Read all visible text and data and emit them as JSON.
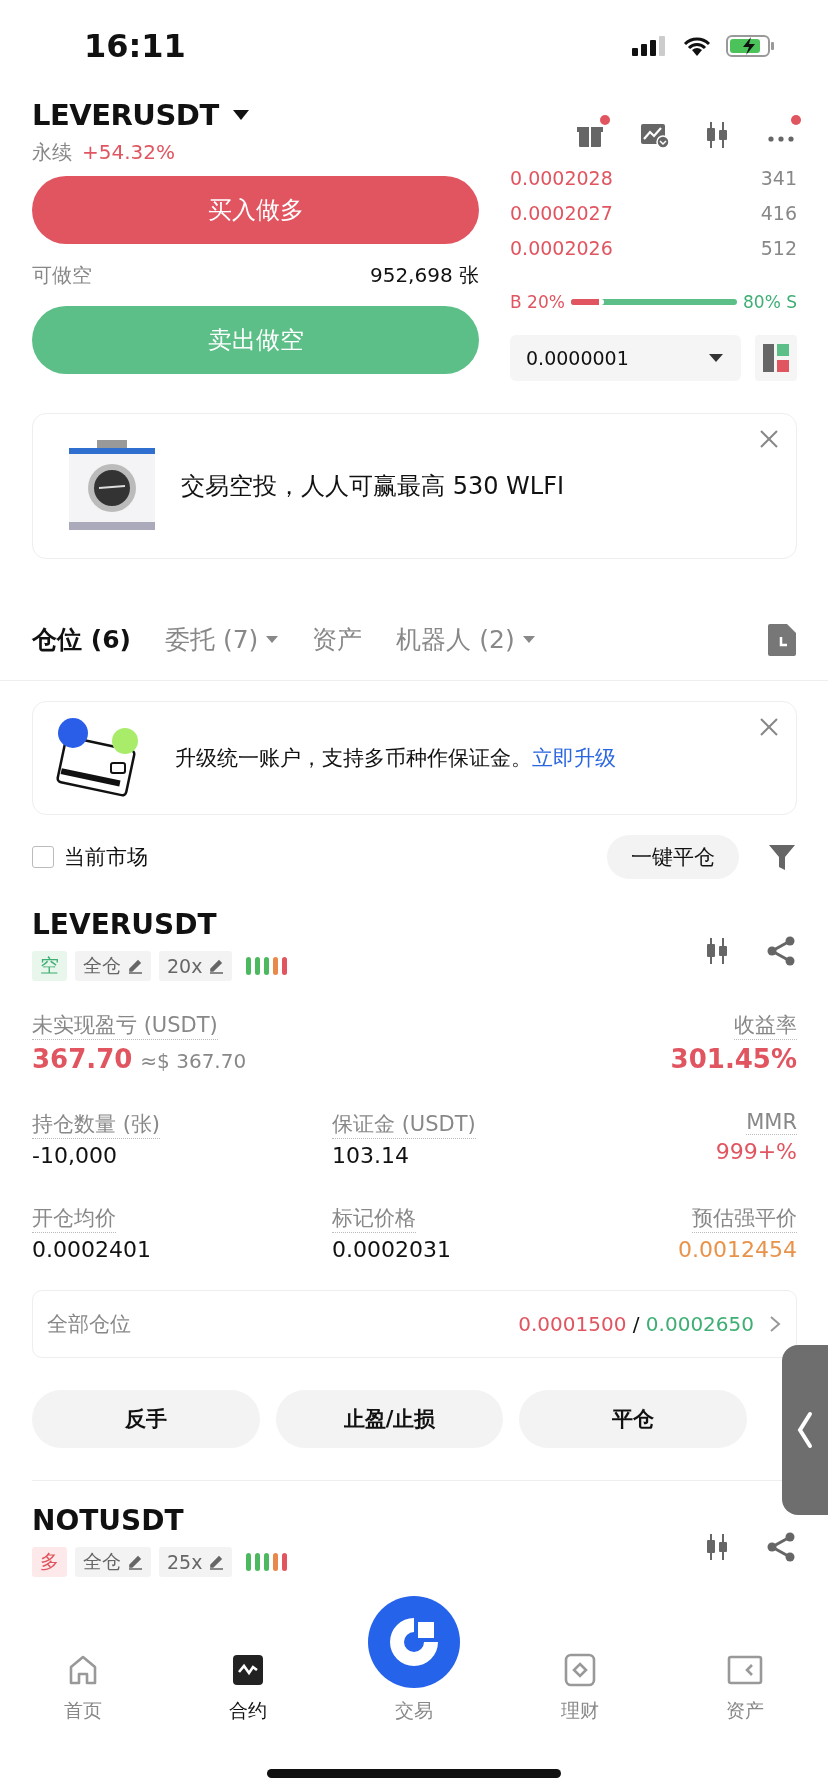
{
  "status_bar": {
    "time": "16:11"
  },
  "header": {
    "symbol": "LEVERUSDT",
    "type": "永续",
    "change": "+54.32%"
  },
  "toolbar": [
    {
      "kind": "gift",
      "badge": true
    },
    {
      "kind": "chart",
      "badge": false
    },
    {
      "kind": "candles",
      "badge": false
    },
    {
      "kind": "more",
      "badge": true
    }
  ],
  "trade": {
    "buy": "买入做多",
    "available_label": "可做空",
    "available_value": "952,698 张",
    "sell": "卖出做空"
  },
  "order_book": {
    "asks": [
      {
        "price": "0.0002028",
        "size": "341"
      },
      {
        "price": "0.0002027",
        "size": "416"
      },
      {
        "price": "0.0002026",
        "size": "512"
      }
    ],
    "buy_label": "B 20%",
    "sell_label": "80% S",
    "level": 0.2,
    "precision": "0.0000001"
  },
  "promo": {
    "text": "交易空投，人人可赢最高 530 WLFI"
  },
  "tabs": [
    {
      "label": "仓位 (6)",
      "selected": true,
      "dropdown": false
    },
    {
      "label": "委托 (7)",
      "selected": false,
      "dropdown": true
    },
    {
      "label": "资产",
      "selected": false,
      "dropdown": false
    },
    {
      "label": "机器人 (2)",
      "selected": false,
      "dropdown": true
    }
  ],
  "notice": {
    "text": "升级统一账户，支持多币种作保证金。",
    "link": "立即升级"
  },
  "filter": {
    "label": "当前市场",
    "checked": false,
    "close_all": "一键平仓"
  },
  "positions": [
    {
      "symbol": "LEVERUSDT",
      "side": "空",
      "kind": "short",
      "margin_mode": "全仓",
      "leverage": "20x",
      "risk_bars": [
        {
          "color": "#4cb860"
        },
        {
          "color": "#4cb860"
        },
        {
          "color": "#4cb860"
        },
        {
          "color": "#e8884a"
        },
        {
          "color": "#e05560"
        }
      ],
      "pnl": {
        "label": "未实现盈亏 (USDT)",
        "value": "367.70",
        "approx": "≈$ 367.70"
      },
      "roe": {
        "label": "收益率",
        "value": "301.45%"
      },
      "grid": [
        {
          "label": "持仓数量 (张)",
          "value": "-10,000",
          "kind": "plain"
        },
        {
          "label": "保证金 (USDT)",
          "value": "103.14",
          "kind": "plain"
        },
        {
          "label": "MMR",
          "value": "999+%",
          "kind": "risk"
        },
        {
          "label": "开仓均价",
          "value": "0.0002401",
          "kind": "plain"
        },
        {
          "label": "标记价格",
          "value": "0.0002031",
          "kind": "plain"
        },
        {
          "label": "预估强平价",
          "value": "0.0012454",
          "kind": "liquidation"
        }
      ],
      "range": {
        "label": "全部仓位",
        "low": "0.0001500",
        "sep": "/",
        "high": "0.0002650"
      },
      "actions": [
        "反手",
        "止盈/止损",
        "平仓"
      ]
    },
    {
      "symbol": "NOTUSDT",
      "side": "多",
      "kind": "long",
      "margin_mode": "全仓",
      "leverage": "25x",
      "risk_bars": [
        {
          "color": "#4cb860"
        },
        {
          "color": "#4cb860"
        },
        {
          "color": "#4cb860"
        },
        {
          "color": "#e8884a"
        },
        {
          "color": "#e05560"
        }
      ]
    }
  ],
  "nav": [
    {
      "label": "首页",
      "kind": "home",
      "selected": false
    },
    {
      "label": "合约",
      "kind": "futures",
      "selected": true
    },
    {
      "label": "交易",
      "kind": "trade",
      "selected": false
    },
    {
      "label": "理财",
      "kind": "earn",
      "selected": false
    },
    {
      "label": "资产",
      "kind": "assets",
      "selected": false
    }
  ]
}
